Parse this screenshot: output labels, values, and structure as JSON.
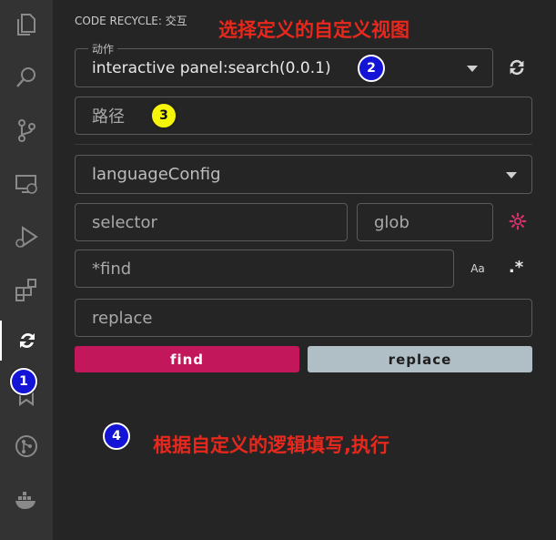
{
  "activity_bar": {
    "icons": [
      "explorer-icon",
      "search-icon",
      "source-control-icon",
      "remote-explorer-icon",
      "run-debug-icon",
      "extensions-icon",
      "code-recycle-icon",
      "bookmark-icon",
      "git-graph-icon",
      "docker-icon"
    ]
  },
  "panel": {
    "title": "CODE RECYCLE: 交互",
    "action_select": {
      "legend": "动作",
      "value": "interactive panel:search(0.0.1)"
    },
    "path_input": {
      "placeholder": "路径"
    },
    "language_select": {
      "value": "languageConfig"
    },
    "selector_input": {
      "placeholder": "selector"
    },
    "glob_input": {
      "placeholder": "glob"
    },
    "find_input": {
      "placeholder": "*find"
    },
    "match_case_label": "Aa",
    "regex_label": ".*",
    "replace_input": {
      "placeholder": "replace"
    },
    "find_button": "find",
    "replace_button": "replace"
  },
  "annotations": {
    "top_note": "选择定义的自定义视图",
    "bottom_note": "根据自定义的逻辑填写,执行",
    "badges": [
      "1",
      "2",
      "3",
      "4"
    ]
  },
  "colors": {
    "find_button": "#c2185b",
    "replace_button": "#b0bec5",
    "annotation_text": "#e8281c",
    "badge_blue": "#1414d6",
    "badge_yellow": "#f5f50a"
  }
}
